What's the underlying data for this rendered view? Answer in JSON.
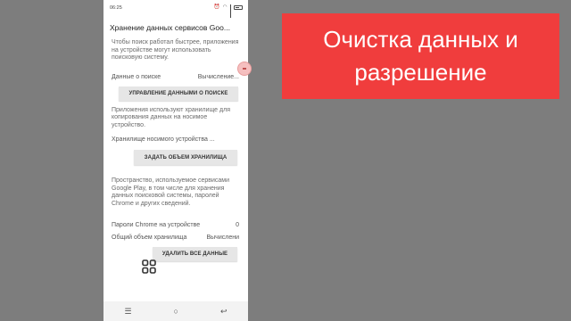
{
  "status_bar": {
    "time": "06:25"
  },
  "screen": {
    "title": "Хранение данных сервисов Goo...",
    "search_section": {
      "description": "Чтобы поиск работал быстрее, приложения на устройстве могут использовать поисковую систему.",
      "row_label": "Данные о поиске",
      "row_value": "Вычисление...",
      "button": "УПРАВЛЕНИЕ ДАННЫМИ О ПОИСКЕ"
    },
    "wearable_section": {
      "description": "Приложения используют хранилище для копирования данных на носимое устройство.",
      "row_label": "Хранилище носимого устройства ...",
      "button": "ЗАДАТЬ ОБЪЕМ ХРАНИЛИЩА"
    },
    "storage_section": {
      "description": "Пространство, используемое сервисами Google Play, в том числе для хранения данных поисковой системы, паролей Chrome и других сведений.",
      "chrome_passwords_label": "Пароли Chrome на устройстве",
      "chrome_passwords_value": "0",
      "total_storage_label": "Общий объем хранилища",
      "total_storage_value": "Вычислени",
      "button": "УДАЛИТЬ ВСЕ ДАННЫЕ"
    }
  },
  "nav_bar": {
    "menu": "☰",
    "home": "○",
    "back": "↩"
  },
  "banner": {
    "line1": "Очистка данных и",
    "line2": "разрешение"
  },
  "colors": {
    "banner": "#f03d3d",
    "background": "#7d7d7d"
  }
}
